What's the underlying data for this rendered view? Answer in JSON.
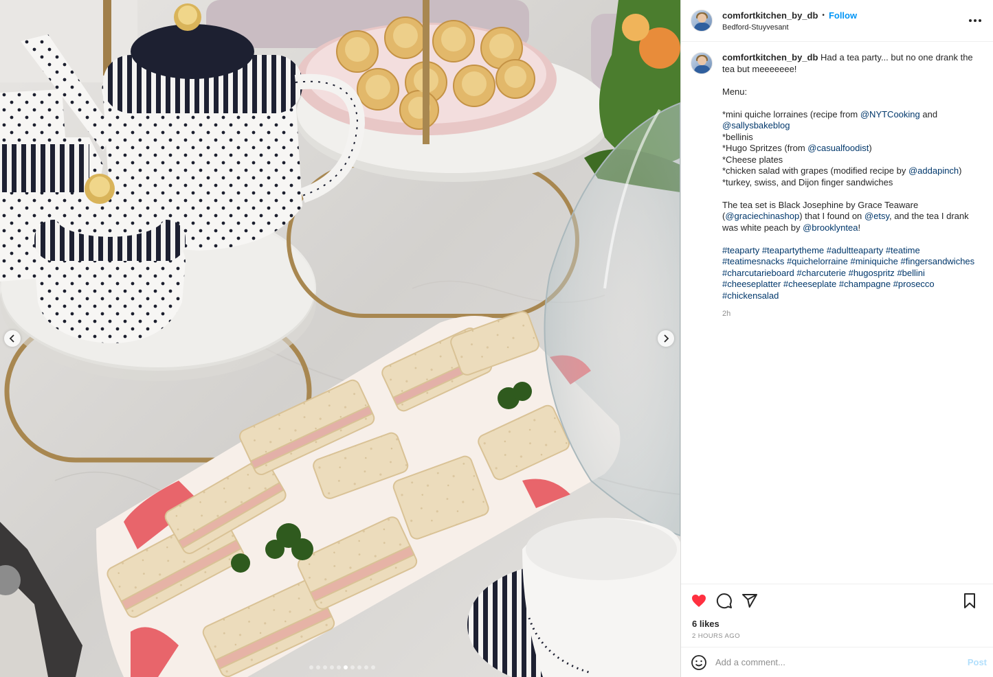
{
  "post": {
    "username": "comfortkitchen_by_db",
    "follow_label": "Follow",
    "separator": "•",
    "location": "Bedford-Stuyvesant",
    "more_icon": "more-horizontal-icon",
    "more_label": "..."
  },
  "caption": {
    "username": "comfortkitchen_by_db",
    "text_intro": " Had a tea party... but no one drank the tea but meeeeeee!",
    "menu_heading": "Menu:",
    "item1_a": "*mini quiche lorraines (recipe from ",
    "item1_m1": "@NYTCooking",
    "item1_b": " and ",
    "item1_m2": "@sallysbakeblog",
    "item2": "*bellinis",
    "item3_a": "*Hugo Spritzes (from ",
    "item3_m": "@casualfoodist",
    "item3_b": ")",
    "item4": "*Cheese plates",
    "item5_a": "*chicken salad with grapes (modified recipe by ",
    "item5_m": "@addapinch",
    "item5_b": ")",
    "item6": "*turkey, swiss, and Dijon finger sandwiches",
    "tea_a": "The tea set is Black Josephine by Grace Teaware (",
    "tea_m1": "@graciechinashop",
    "tea_b": ") that I found on ",
    "tea_m2": "@etsy",
    "tea_c": ", and the tea I drank was white peach by ",
    "tea_m3": "@brooklyntea",
    "tea_d": "!",
    "hashtags": [
      "#teaparty",
      "#teapartytheme",
      "#adultteaparty",
      "#teatime",
      "#teatimesnacks",
      "#quichelorraine",
      "#miniquiche",
      "#fingersandwiches",
      "#charcutarieboard",
      "#charcuterie",
      "#hugospritz",
      "#bellini",
      "#cheeseplatter",
      "#cheeseplate",
      "#champagne",
      "#prosecco",
      "#chickensalad"
    ],
    "time": "2h"
  },
  "engagement": {
    "likes": "6 likes",
    "post_time": "2 HOURS AGO",
    "liked": true,
    "heart_color": "#ff3040"
  },
  "comment": {
    "placeholder": "Add a comment...",
    "post_label": "Post"
  },
  "carousel": {
    "count": 10,
    "active_index": 5
  },
  "colors": {
    "link": "#00376b",
    "follow": "#0095f6",
    "muted": "#8e8e8e"
  }
}
